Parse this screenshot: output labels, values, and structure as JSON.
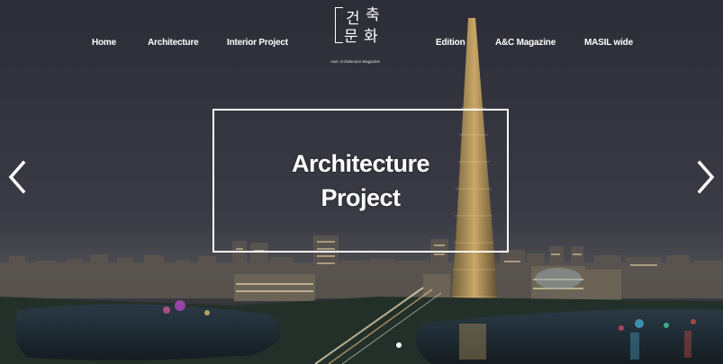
{
  "nav": {
    "left": [
      "Home",
      "Architecture",
      "Interior Project"
    ],
    "right": [
      "Edition",
      "A&C Magazine",
      "MASIL wide"
    ]
  },
  "logo": {
    "chars": [
      "건",
      "축",
      "문",
      "화"
    ],
    "tagline": "A&C Architecture Magazine"
  },
  "hero": {
    "title_line1": "Architecture",
    "title_line2": "Project"
  },
  "icons": {
    "prev": "chevron-left-icon",
    "next": "chevron-right-icon"
  },
  "colors": {
    "text": "#ffffff",
    "sky": "#34343f"
  }
}
